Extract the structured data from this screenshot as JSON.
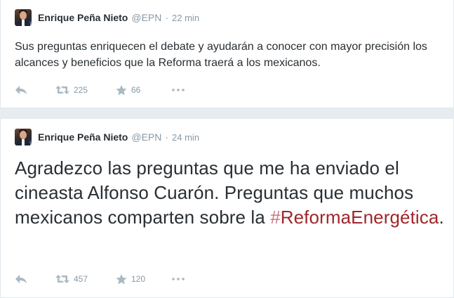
{
  "tweets": [
    {
      "author_name": "Enrique Peña Nieto",
      "handle": "@EPN",
      "separator": "·",
      "time": "22 min",
      "text": "Sus preguntas enriquecen el debate y ayudarán a conocer con mayor precisión los alcances y beneficios que la Reforma traerá a los mexicanos.",
      "retweets": "225",
      "favorites": "66"
    },
    {
      "author_name": "Enrique Peña Nieto",
      "handle": "@EPN",
      "separator": "·",
      "time": "24 min",
      "text_before": "Agradezco las preguntas que me ha enviado el cineasta Alfonso Cuarón. Preguntas que muchos mexicanos comparten sobre la ",
      "hashtag_symbol": "#",
      "hashtag_word": "ReformaEnergética",
      "text_after": ".",
      "retweets": "457",
      "favorites": "120"
    }
  ],
  "colors": {
    "background": "#e6ecf0",
    "card": "#ffffff",
    "text": "#292f33",
    "muted": "#8899a6",
    "icon": "#aab8c2",
    "hashtag": "#a0262c"
  },
  "icons": [
    "reply-icon",
    "retweet-icon",
    "star-icon",
    "more-icon"
  ]
}
